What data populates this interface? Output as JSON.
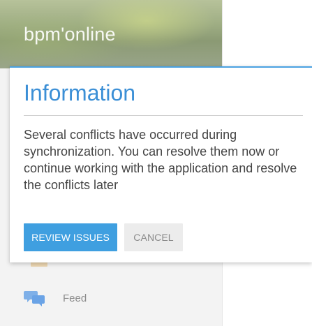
{
  "sidebar": {
    "logo": "bpm'online",
    "items": [
      {
        "label": "Feed",
        "icon": "chat-bubbles-icon"
      }
    ]
  },
  "dialog": {
    "title": "Information",
    "message": "Several conflicts have occurred during synchronization. You can resolve them now or continue working with the application and resolve the conflicts later",
    "primary_button": "REVIEW ISSUES",
    "secondary_button": "CANCEL"
  },
  "colors": {
    "accent": "#3b8fd6",
    "primary_button": "#3f9fe0",
    "secondary_button": "#ececec",
    "feed_icon": "#7fb0e8"
  }
}
